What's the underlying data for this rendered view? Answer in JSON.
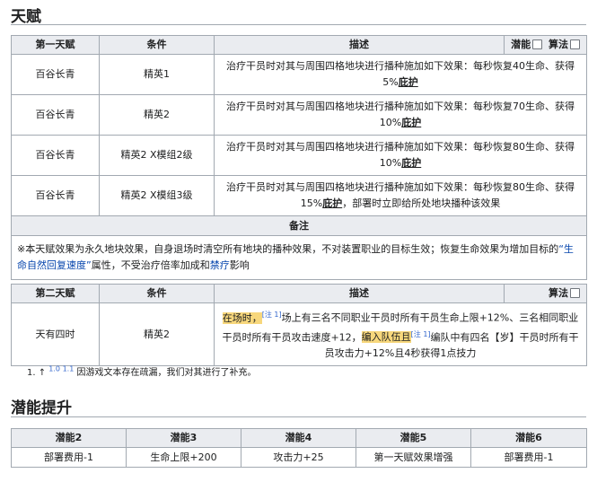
{
  "talent_section": {
    "title": "天赋"
  },
  "talent1_table": {
    "headers": [
      "第一天赋",
      "条件",
      "描述",
      "潜能",
      "算法"
    ],
    "rows": [
      {
        "name": "百谷长青",
        "condition": "精英1",
        "desc_pre": "治疗干员时对其与周围四格地块进行播种施加如下效果：每秒恢复40生命、获得5%",
        "desc_term": "庇护",
        "desc_post": ""
      },
      {
        "name": "百谷长青",
        "condition": "精英2",
        "desc_pre": "治疗干员时对其与周围四格地块进行播种施加如下效果：每秒恢复70生命、获得10%",
        "desc_term": "庇护",
        "desc_post": ""
      },
      {
        "name": "百谷长青",
        "condition": "精英2 X模组2级",
        "desc_pre": "治疗干员时对其与周围四格地块进行播种施加如下效果：每秒恢复80生命、获得10%",
        "desc_term": "庇护",
        "desc_post": ""
      },
      {
        "name": "百谷长青",
        "condition": "精英2 X模组3级",
        "desc_pre": "治疗干员时对其与周围四格地块进行播种施加如下效果：每秒恢复80生命、获得15%",
        "desc_term": "庇护",
        "desc_post": "，部署时立即给所处地块播种该效果"
      }
    ],
    "note_header": "备注",
    "note_part1": "※本天赋效果为永久地块效果，自身退场时清空所有地块的播种效果，不对装置职业的目标生效；恢复生命效果为增加目标的",
    "note_term": "“生命自然回复速度”",
    "note_part2": "属性，不受治疗倍率加成和",
    "note_link": "禁疗",
    "note_part3": "影响"
  },
  "talent2_table": {
    "headers": [
      "第二天赋",
      "条件",
      "描述",
      "算法"
    ],
    "row": {
      "name": "天有四时",
      "condition": "精英2",
      "hl1": "在场时，",
      "ref1": "[注 1]",
      "text1": "场上有三名不同职业干员时所有干员生命上限+12%、三名相同职业干员时所有干员攻击速度+12，",
      "hl2": "编入队伍且",
      "ref2": "[注 1]",
      "text2": "编队中有四名【岁】干员时所有干员攻击力+12%且4秒获得1点技力"
    }
  },
  "footnote": {
    "marker": "1. ↑",
    "refs": "1.0 1.1",
    "text": "因游戏文本存在疏漏，我们对其进行了补充。"
  },
  "potential_section": {
    "title": "潜能提升",
    "headers": [
      "潜能2",
      "潜能3",
      "潜能4",
      "潜能5",
      "潜能6"
    ],
    "values": [
      "部署费用-1",
      "生命上限+200",
      "攻击力+25",
      "第一天赋效果增强",
      "部署费用-1"
    ]
  }
}
